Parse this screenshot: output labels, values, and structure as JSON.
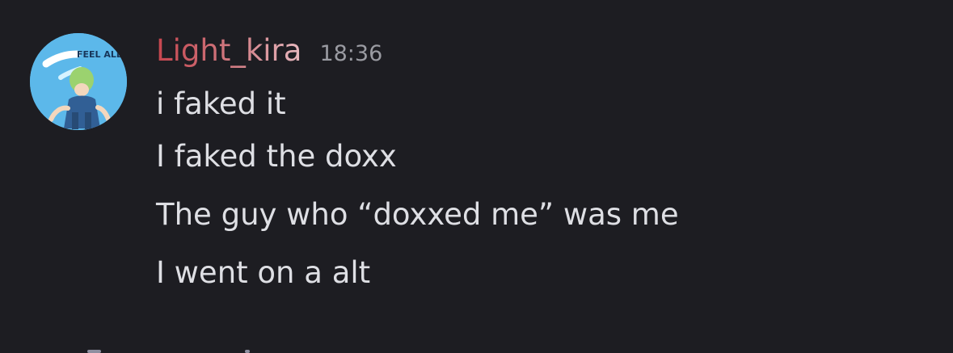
{
  "message": {
    "username": "Light_kira",
    "timestamp": "18:36",
    "avatar": {
      "icon": "user-avatar-icon",
      "badge_text": "FEEL ALL ON",
      "background_color": "#5cb8ea"
    },
    "lines": [
      "i faked it",
      "I faked the doxx",
      "The guy who “doxxed me” was me",
      "I went on a alt"
    ]
  },
  "colors": {
    "background": "#1d1d22",
    "username": "#c9555c",
    "timestamp": "#9a9ba2",
    "message_text": "#dedfe4"
  }
}
